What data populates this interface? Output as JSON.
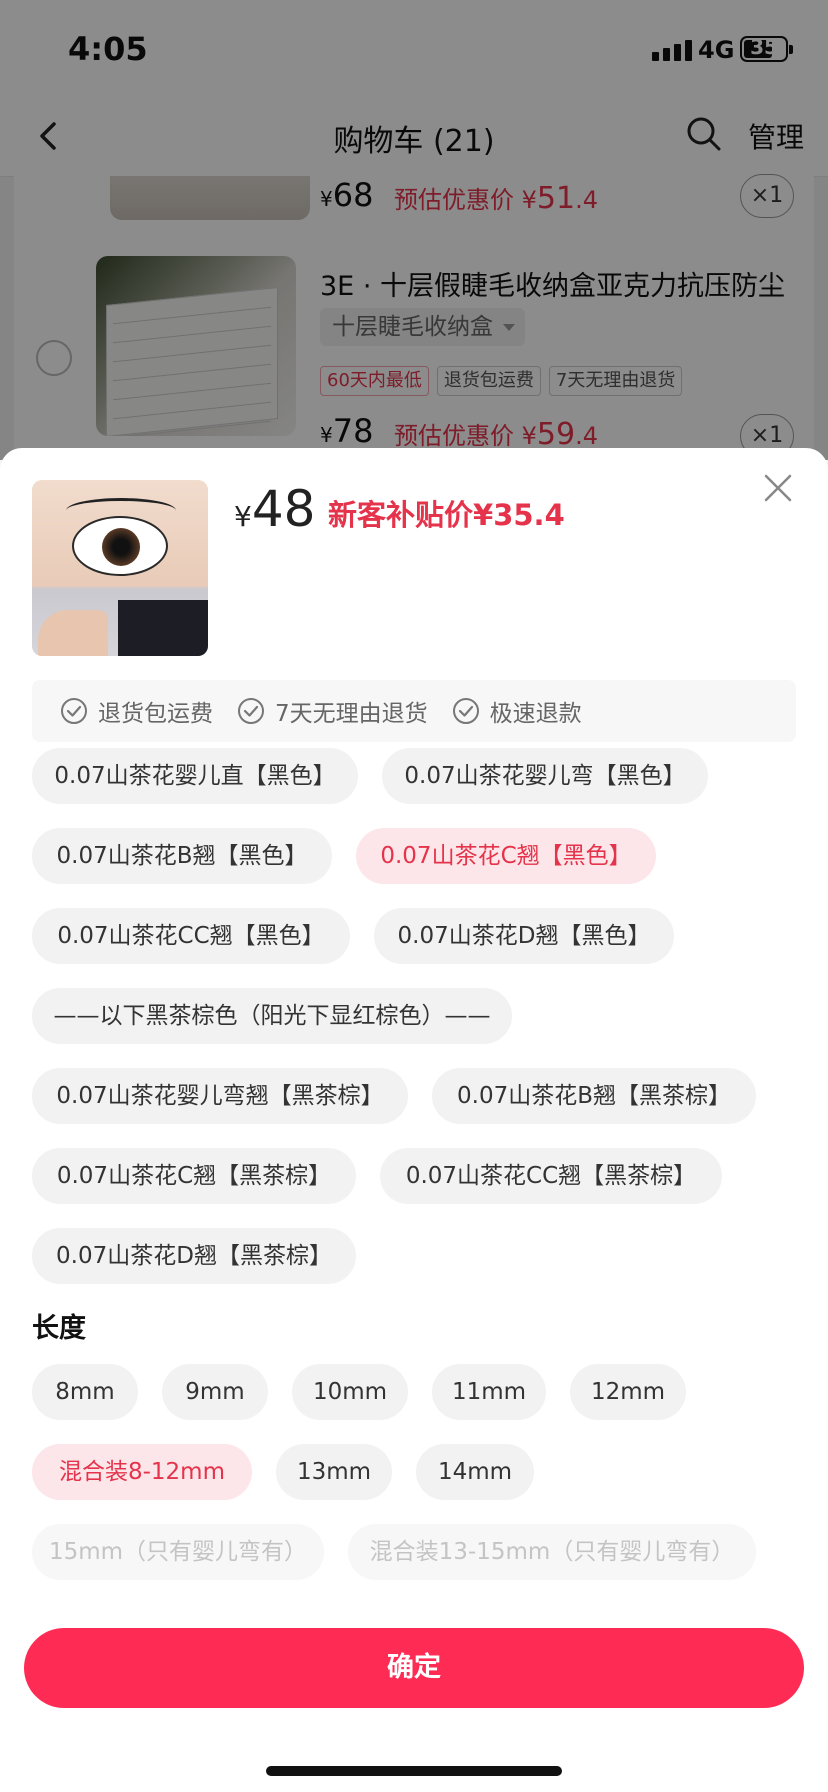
{
  "status_bar": {
    "time": "4:05",
    "network": "4G",
    "battery": "35"
  },
  "header": {
    "title": "购物车 (21)",
    "manage_label": "管理"
  },
  "cart": {
    "item1": {
      "currency": "¥",
      "price": "68",
      "est_label": "预估优惠价",
      "est_currency": "¥",
      "est_int": "51",
      "est_dec": ".4",
      "qty": "×1"
    },
    "item2": {
      "title": "3E · 十层假睫毛收纳盒亚克力抗压防尘",
      "spec": "十层睫毛收纳盒",
      "tags": [
        "60天内最低",
        "退货包运费",
        "7天无理由退货"
      ],
      "currency": "¥",
      "price": "78",
      "est_label": "预估优惠价",
      "est_currency": "¥",
      "est_int": "59",
      "est_dec": ".4",
      "qty": "×1"
    }
  },
  "sheet": {
    "currency": "¥",
    "price": "48",
    "subsidy_label": "新客补贴价",
    "subsidy_price": "¥35.4",
    "benefits": [
      "退货包运费",
      "7天无理由退货",
      "极速退款"
    ],
    "style_options": [
      "0.07山茶花婴儿直【黑色】",
      "0.07山茶花婴儿弯【黑色】",
      "0.07山茶花B翘【黑色】",
      "0.07山茶花C翘【黑色】",
      "0.07山茶花CC翘【黑色】",
      "0.07山茶花D翘【黑色】",
      "——以下黑茶棕色（阳光下显红棕色）——",
      "0.07山茶花婴儿弯翘【黑茶棕】",
      "0.07山茶花B翘【黑茶棕】",
      "0.07山茶花C翘【黑茶棕】",
      "0.07山茶花CC翘【黑茶棕】",
      "0.07山茶花D翘【黑茶棕】"
    ],
    "style_selected": "0.07山茶花C翘【黑色】",
    "length_title": "长度",
    "length_options": [
      "8mm",
      "9mm",
      "10mm",
      "11mm",
      "12mm",
      "混合装8-12mm",
      "13mm",
      "14mm",
      "15mm（只有婴儿弯有）",
      "混合装13-15mm（只有婴儿弯有）"
    ],
    "length_selected": "混合装8-12mm",
    "length_disabled": [
      "15mm（只有婴儿弯有）",
      "混合装13-15mm（只有婴儿弯有）"
    ],
    "confirm_label": "确定"
  },
  "colors": {
    "accent": "#fe2c55",
    "price_red": "#e5334b",
    "selected_bg": "#fde6e9"
  }
}
